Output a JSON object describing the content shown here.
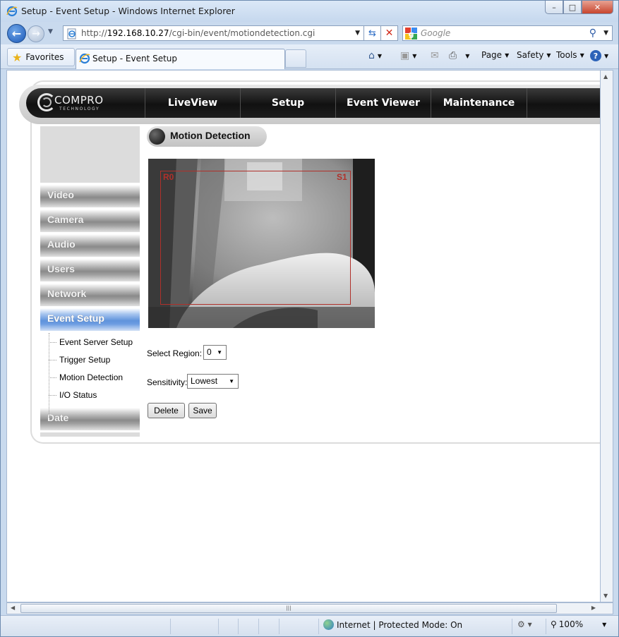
{
  "window": {
    "title": "Setup - Event Setup - Windows Internet Explorer",
    "controls": {
      "minimize": "–",
      "maximize": "□",
      "close": "✕"
    }
  },
  "addressbar": {
    "url_prefix": "http://",
    "url_host": "192.168.10.27",
    "url_path": "/cgi-bin/event/motiondetection.cgi",
    "search_placeholder": "Google"
  },
  "favorites": {
    "label": "Favorites"
  },
  "tab": {
    "label": "Setup - Event Setup"
  },
  "commandbar": {
    "page": "Page",
    "safety": "Safety",
    "tools": "Tools"
  },
  "statusbar": {
    "zone": "Internet | Protected Mode: On",
    "zoom": "100%"
  },
  "site": {
    "logo_text": "COMPRO",
    "logo_sub": "TECHNOLOGY",
    "nav": [
      "LiveView",
      "Setup",
      "Event Viewer",
      "Maintenance"
    ],
    "sidebar": {
      "items": [
        "Video",
        "Camera",
        "Audio",
        "Users",
        "Network",
        "Event Setup"
      ],
      "subitems": [
        "Event Server Setup",
        "Trigger Setup",
        "Motion Detection",
        "I/O Status"
      ],
      "after": [
        "Date"
      ]
    },
    "section_title": "Motion Detection",
    "video": {
      "region_label": "R0",
      "sensitivity_label": "S1"
    },
    "form": {
      "region_label": "Select Region:",
      "region_value": "0",
      "sensitivity_label": "Sensitivity:",
      "sensitivity_value": "Lowest",
      "delete_label": "Delete",
      "save_label": "Save"
    }
  }
}
